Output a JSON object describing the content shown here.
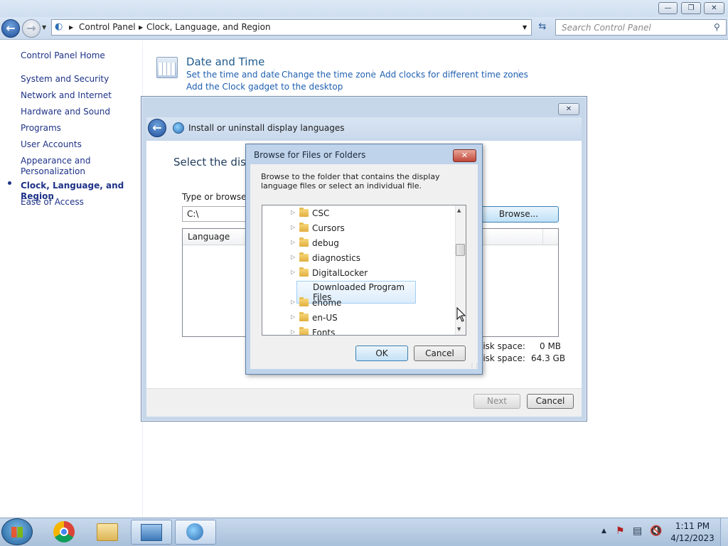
{
  "address_bar": {
    "crumbs": [
      "Control Panel",
      "Clock, Language, and Region"
    ],
    "search_placeholder": "Search Control Panel"
  },
  "left_nav": {
    "home": "Control Panel Home",
    "items": [
      "System and Security",
      "Network and Internet",
      "Hardware and Sound",
      "Programs",
      "User Accounts",
      "Appearance and Personalization",
      "Clock, Language, and Region",
      "Ease of Access"
    ],
    "selected_index": 6
  },
  "date_time": {
    "title": "Date and Time",
    "links": [
      "Set the time and date",
      "Change the time zone",
      "Add clocks for different time zones",
      "Add the Clock gadget to the desktop"
    ]
  },
  "wizard": {
    "title": "Install or uninstall display languages",
    "heading": "Select the disp",
    "type_label": "Type or browse t",
    "path_value": "C:\\",
    "browse_label": "Browse...",
    "column_language": "Language",
    "disk1_label": "lisk space:",
    "disk1_value": "0 MB",
    "disk2_label": "lisk space:",
    "disk2_value": "64.3 GB",
    "next_label": "Next",
    "cancel_label": "Cancel"
  },
  "browse_dialog": {
    "title": "Browse for Files or Folders",
    "description": "Browse to the folder that contains the display language files or select an individual file.",
    "folders": [
      "CSC",
      "Cursors",
      "debug",
      "diagnostics",
      "DigitalLocker",
      "Downloaded Program Files",
      "ehome",
      "en-US",
      "Fonts"
    ],
    "selected_folder": "Downloaded Program Files",
    "ok_label": "OK",
    "cancel_label": "Cancel"
  },
  "taskbar": {
    "time": "1:11 PM",
    "date": "4/12/2023"
  }
}
